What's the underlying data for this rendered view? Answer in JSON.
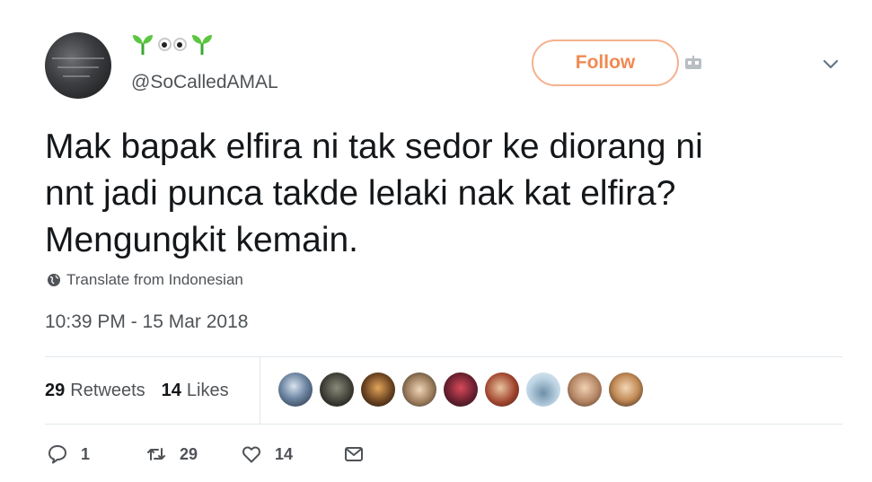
{
  "tweet": {
    "display_name_icons": [
      "seedling-icon",
      "eyes-icon",
      "seedling-icon"
    ],
    "handle": "@SoCalledAMAL",
    "follow_label": "Follow",
    "text_lines": [
      "Mak bapak elfira ni tak sedor ke diorang ni",
      "nnt jadi punca takde lelaki nak kat elfira?",
      "Mengungkit kemain."
    ],
    "translate_label": "Translate from Indonesian",
    "timestamp": "10:39 PM - 15 Mar 2018",
    "stats": {
      "retweets_count": "29",
      "retweets_label": "Retweets",
      "likes_count": "14",
      "likes_label": "Likes"
    },
    "likers_count": 9,
    "actions": {
      "reply_count": "1",
      "retweet_count": "29",
      "like_count": "14"
    }
  },
  "colors": {
    "follow_accent": "#f08a53",
    "follow_border": "#f5b18f",
    "text": "#14171a",
    "secondary": "#4f5357",
    "divider": "#e1e8ed"
  }
}
